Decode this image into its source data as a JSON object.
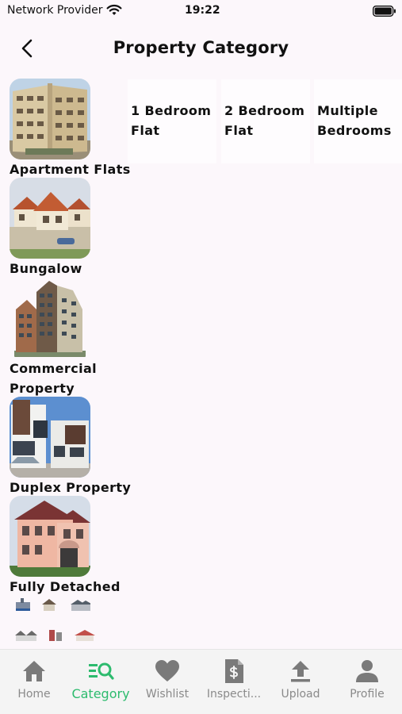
{
  "status_bar": {
    "carrier": "Network Provider",
    "time": "19:22"
  },
  "header": {
    "title": "Property Category"
  },
  "categories": [
    {
      "label": "Apartment Flats",
      "icon": "apartment-building-photo"
    },
    {
      "label": "Bungalow",
      "icon": "bungalow-house-photo"
    },
    {
      "label": "Commercial Property",
      "icon": "commercial-tower-photo"
    },
    {
      "label": "Duplex Property",
      "icon": "duplex-house-photo"
    },
    {
      "label": "Fully Detached",
      "icon": "detached-house-photo"
    }
  ],
  "subcategories": [
    {
      "label": "1 Bedroom Flat"
    },
    {
      "label": "2 Bedroom Flat"
    },
    {
      "label": "Multiple Bedrooms"
    }
  ],
  "bottom_nav": [
    {
      "label": "Home",
      "icon": "home-icon",
      "active": false
    },
    {
      "label": "Category",
      "icon": "category-search-icon",
      "active": true
    },
    {
      "label": "Wishlist",
      "icon": "heart-icon",
      "active": false
    },
    {
      "label": "Inspecti...",
      "icon": "document-dollar-icon",
      "active": false
    },
    {
      "label": "Upload",
      "icon": "upload-icon",
      "active": false
    },
    {
      "label": "Profile",
      "icon": "person-icon",
      "active": false
    }
  ],
  "colors": {
    "accent": "#2dbb6e",
    "inactive": "#8a8a8a",
    "background": "#fcf7fb",
    "nav_bg": "#f4f4f4"
  }
}
